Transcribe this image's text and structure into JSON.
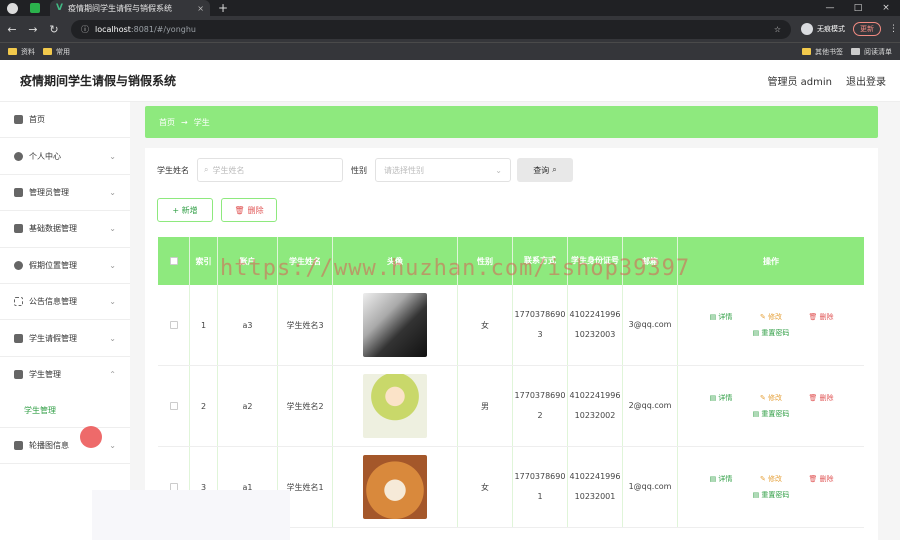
{
  "browser": {
    "tab_title": "疫情期间学生请假与销假系统",
    "url_host": "localhost",
    "url_path": ":8081/#/yonghu",
    "incognito": "无痕模式",
    "update": "更新",
    "bookmarks": [
      "资料",
      "常用"
    ],
    "bookmarks_right": [
      "其他书签",
      "阅读清单"
    ]
  },
  "header": {
    "title": "疫情期间学生请假与销假系统",
    "user": "管理员 admin",
    "logout": "退出登录"
  },
  "sidebar": {
    "items": [
      {
        "label": "首页",
        "icon": "home-icon"
      },
      {
        "label": "个人中心",
        "icon": "user-icon"
      },
      {
        "label": "管理员管理",
        "icon": "admin-icon"
      },
      {
        "label": "基础数据管理",
        "icon": "send-icon"
      },
      {
        "label": "假期位置管理",
        "icon": "location-icon"
      },
      {
        "label": "公告信息管理",
        "icon": "expand-icon"
      },
      {
        "label": "学生请假管理",
        "icon": "sliders-icon"
      },
      {
        "label": "学生管理",
        "icon": "chart-icon"
      }
    ],
    "subitem": "学生管理",
    "last_item": "轮播图信息"
  },
  "breadcrumb": {
    "home": "首页",
    "arrow": "→",
    "current": "学生"
  },
  "search": {
    "name_label": "学生姓名",
    "name_placeholder": "学生姓名",
    "gender_label": "性别",
    "gender_placeholder": "请选择性别",
    "query": "查询"
  },
  "actions": {
    "add": "+ 新增",
    "delete": "删除"
  },
  "table": {
    "headers": [
      "",
      "索引",
      "账户",
      "学生姓名",
      "头像",
      "性别",
      "联系方式",
      "学生身份证号",
      "邮箱",
      "操作"
    ],
    "rows": [
      {
        "index": "1",
        "account": "a3",
        "name": "学生姓名3",
        "gender": "女",
        "phone": "17703786903",
        "idcard": "410224199610232003",
        "email": "3@qq.com"
      },
      {
        "index": "2",
        "account": "a2",
        "name": "学生姓名2",
        "gender": "男",
        "phone": "17703786902",
        "idcard": "410224199610232002",
        "email": "2@qq.com"
      },
      {
        "index": "3",
        "account": "a1",
        "name": "学生姓名1",
        "gender": "女",
        "phone": "17703786901",
        "idcard": "410224199610232001",
        "email": "1@qq.com"
      }
    ],
    "ops": {
      "detail": "详情",
      "edit": "修改",
      "delete": "删除",
      "reset": "重置密码"
    }
  },
  "watermark": "https://www.huzhan.com/ishop39397",
  "colors": {
    "accent": "#8ee97e",
    "delete": "#e05555",
    "edit": "#e6a23c",
    "detail": "#2f9e44"
  }
}
